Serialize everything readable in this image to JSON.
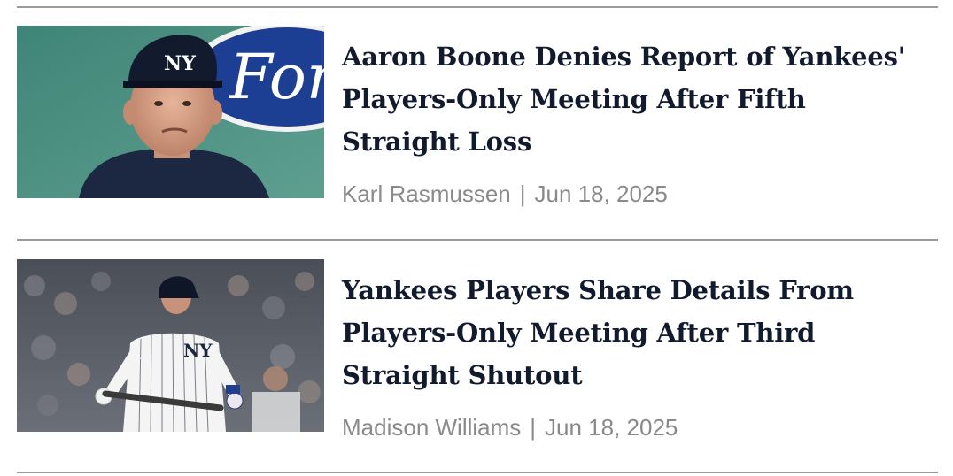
{
  "articles": [
    {
      "headline": "Aaron Boone Denies Report of Yankees' Players-Only Meeting After Fifth Straight Loss",
      "author": "Karl Rasmussen",
      "separator": "|",
      "date": "Jun 18, 2025",
      "thumbnail": {
        "description": "Manager in navy Yankees cap and jacket in dugout, Ford logo on wall behind",
        "cap_logo": "NY",
        "sign_text": "For"
      }
    },
    {
      "headline": "Yankees Players Share Details From Players-Only Meeting After Third Straight Shutout",
      "author": "Madison Williams",
      "separator": "|",
      "date": "Jun 18, 2025",
      "thumbnail": {
        "description": "Yankees batter in pinstripe uniform holding bat with crowd in background",
        "jersey_logo": "NY"
      }
    }
  ],
  "colors": {
    "headline": "#121a2e",
    "meta": "#8a8a8a",
    "divider": "#9a9a9a",
    "ford_blue": "#1c3f94",
    "yankees_navy": "#1c2841"
  }
}
